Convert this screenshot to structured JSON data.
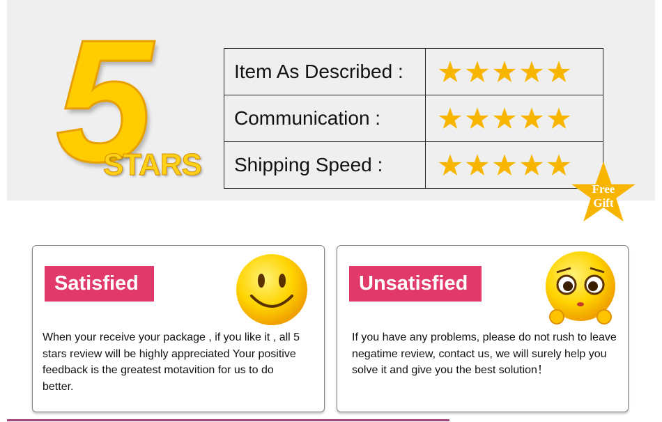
{
  "logo": {
    "number": "5",
    "word": "STARS"
  },
  "ratings": [
    {
      "label": "Item As Described :",
      "stars": 5
    },
    {
      "label": "Communication :",
      "stars": 5
    },
    {
      "label": "Shipping Speed :",
      "stars": 5
    }
  ],
  "gift": {
    "line1": "Free",
    "line2": "Gift"
  },
  "satisfied": {
    "title": "Satisfied",
    "text": "When your receive your package , if you like it , all 5 stars review will be highly appreciated Your positive feedback is the greatest motavition for us to do better."
  },
  "unsatisfied": {
    "title": "Unsatisfied",
    "text": "If you have any problems, please do not rush to leave negatime review, contact us, we will surely help you solve it and give you the best solution！"
  },
  "colors": {
    "star": "#f7b500",
    "badge": "#e2396b",
    "background": "#efefef"
  }
}
